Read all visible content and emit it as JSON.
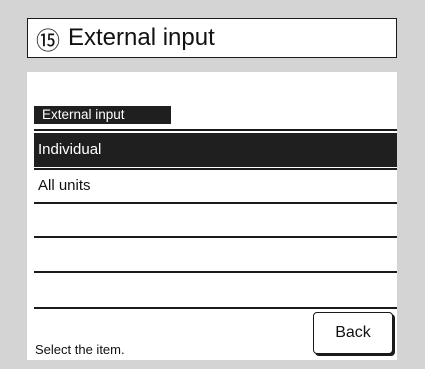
{
  "header": {
    "number": "⑮",
    "title": "External input"
  },
  "section": {
    "label": "External input"
  },
  "list": {
    "items": [
      {
        "label": "Individual",
        "selected": true
      },
      {
        "label": "All units",
        "selected": false
      },
      {
        "label": "",
        "selected": false
      },
      {
        "label": "",
        "selected": false
      },
      {
        "label": "",
        "selected": false
      }
    ]
  },
  "footer": {
    "status": "Select the item.",
    "back_label": "Back"
  }
}
